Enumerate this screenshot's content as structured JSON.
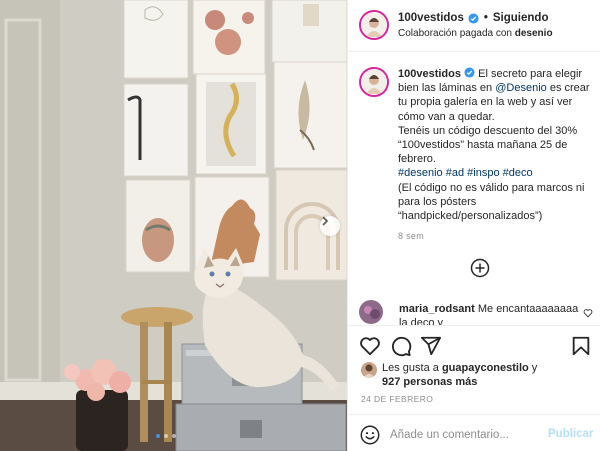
{
  "post": {
    "carousel": {
      "total_slides": 3,
      "current_slide": 1
    }
  },
  "header": {
    "username": "100vestidos",
    "separator": "•",
    "follow_label": "Siguiendo",
    "paid_prefix": "Colaboración pagada con",
    "paid_partner": "desenio"
  },
  "caption": {
    "username": "100vestidos",
    "text_1": "El secreto para elegir bien las láminas en",
    "mention": "@Desenio",
    "text_2": "es crear tu propia galería en la web y así ver cómo van a quedar.",
    "text_3": "Tenéis un código descuento del 30% “100vestidos” hasta mañana 25 de febrero.",
    "hashtags": [
      "#desenio",
      "#ad",
      "#inspo",
      "#deco"
    ],
    "text_4": "(El código no es válido para marcos ni para los pósters “handpicked/personalizados”)",
    "time": "8 sem"
  },
  "comment": {
    "username": "maria_rodsant",
    "text": "Me encantaaaaaaaa la deco y"
  },
  "likes": {
    "prefix": "Les gusta a",
    "user": "guapayconestilo",
    "joiner": "y",
    "others": "927 personas más"
  },
  "date": "24 DE FEBRERO",
  "add_comment": {
    "placeholder": "Añade un comentario...",
    "publish_label": "Publicar"
  },
  "colors": {
    "link": "#00376b",
    "verified": "#3897f0",
    "publish_disabled": "#b2dffc",
    "muted": "#8e8e8e"
  },
  "icons": [
    "chevron-right-icon",
    "verified-icon",
    "plus-circle-icon",
    "heart-icon",
    "comment-icon",
    "share-icon",
    "bookmark-icon",
    "emoji-icon"
  ]
}
